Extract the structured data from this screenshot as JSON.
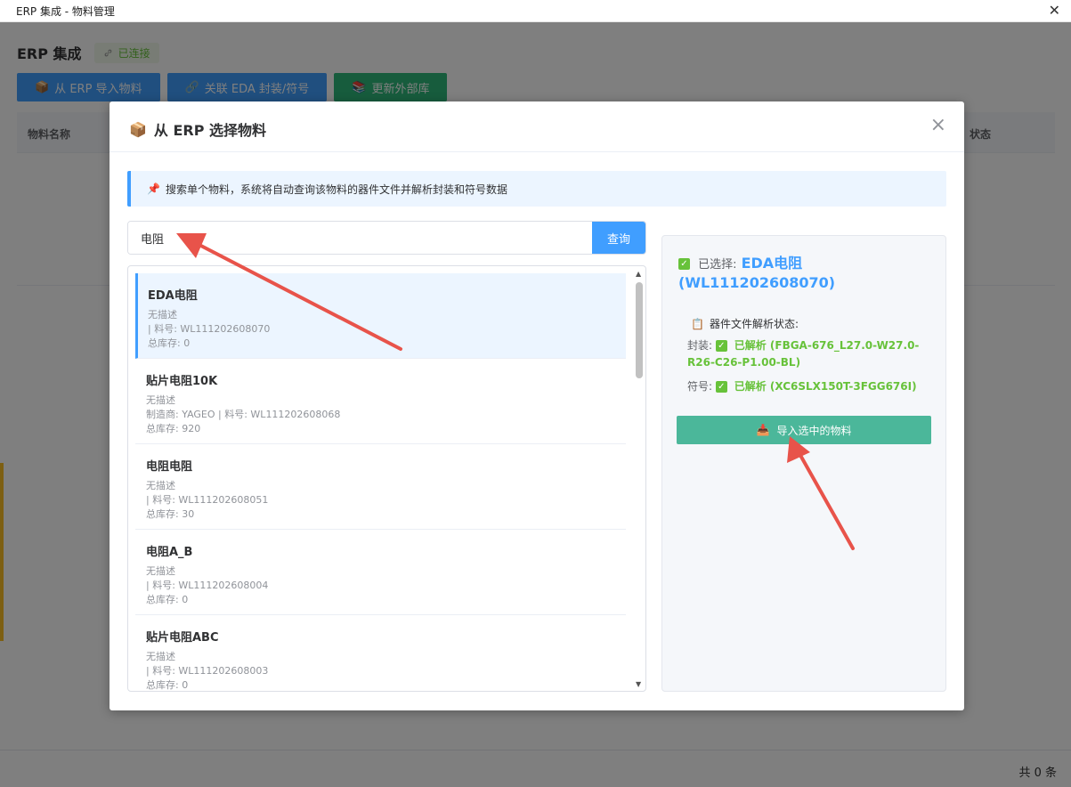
{
  "window": {
    "title": "ERP 集成 - 物料管理",
    "close_glyph": "✕"
  },
  "app": {
    "title": "ERP 集成",
    "connection_badge": "已连接",
    "toolbar": [
      {
        "label": "从 ERP 导入物料",
        "icon": "package-icon"
      },
      {
        "label": "关联 EDA 封装/符号",
        "icon": "link-icon"
      },
      {
        "label": "更新外部库",
        "icon": "books-icon"
      }
    ],
    "table_headers": {
      "name": "物料名称",
      "status": "状态"
    },
    "total_text": "共 0 条"
  },
  "modal": {
    "title": "从 ERP 选择物料",
    "close_glyph": "×",
    "tip": "搜索单个物料，系统将自动查询该物料的器件文件并解析封装和符号数据",
    "search": {
      "value": "电阻",
      "placeholder": "",
      "button": "查询"
    },
    "items": [
      {
        "name": "EDA电阻",
        "desc": "无描述",
        "meta": "| 料号: WL111202608070",
        "stock": "总库存: 0",
        "selected": true
      },
      {
        "name": "贴片电阻10K",
        "desc": "无描述",
        "meta": "制造商: YAGEO | 料号: WL111202608068",
        "stock": "总库存: 920",
        "selected": false
      },
      {
        "name": "电阻电阻",
        "desc": "无描述",
        "meta": "| 料号: WL111202608051",
        "stock": "总库存: 30",
        "selected": false
      },
      {
        "name": "电阻A_B",
        "desc": "无描述",
        "meta": "| 料号: WL111202608004",
        "stock": "总库存: 0",
        "selected": false
      },
      {
        "name": "贴片电阻ABC",
        "desc": "无描述",
        "meta": "| 料号: WL111202608003",
        "stock": "总库存: 0",
        "selected": false
      }
    ],
    "detail": {
      "selected_prefix": "已选择:",
      "selected_value": "EDA电阻 (WL111202608070)",
      "status_title": "器件文件解析状态:",
      "footprint_label": "封装:",
      "footprint_value": "已解析 (FBGA-676_L27.0-W27.0-R26-C26-P1.00-BL)",
      "symbol_label": "符号:",
      "symbol_value": "已解析 (XC6SLX150T-3FGG676I)",
      "import_button": "导入选中的物料"
    }
  },
  "colors": {
    "primary": "#409eff",
    "success": "#67c23a",
    "teal": "#4bb79a",
    "arrow": "#e8534a"
  }
}
